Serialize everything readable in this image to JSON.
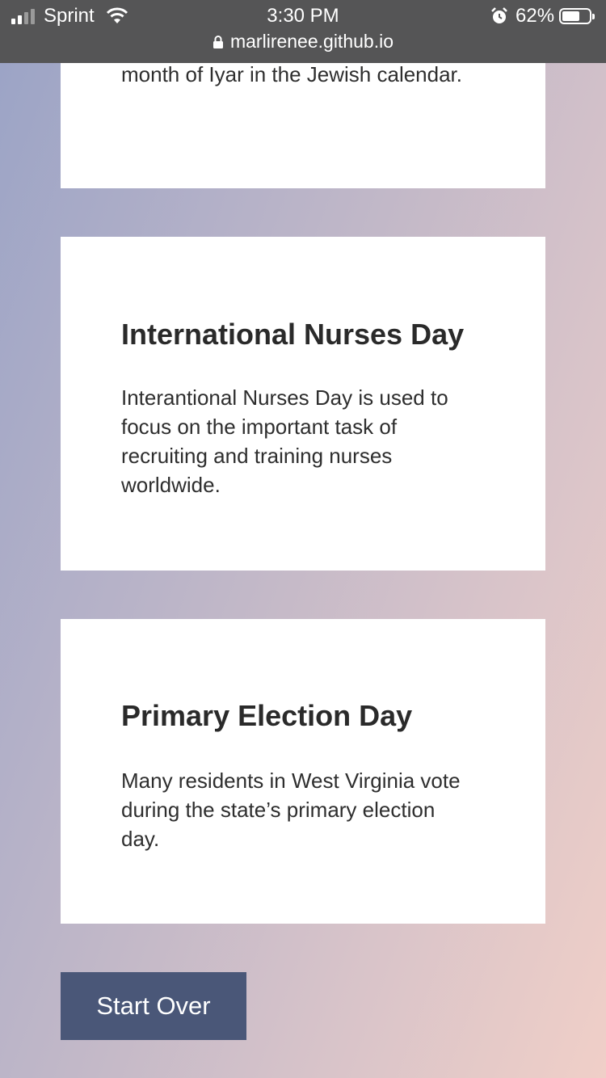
{
  "status_bar": {
    "carrier": "Sprint",
    "time": "3:30 PM",
    "battery": "62%",
    "url": "marlirenee.github.io"
  },
  "cards": [
    {
      "title": "",
      "body": "month of Iyar in the Jewish calendar."
    },
    {
      "title": "International Nurses Day",
      "body": "Interantional Nurses Day is used to focus on the important task of recruiting and training nurses worldwide."
    },
    {
      "title": "Primary Election Day",
      "body": "Many residents in West Virginia vote during the state’s primary election day."
    }
  ],
  "actions": {
    "start_over": "Start Over"
  },
  "colors": {
    "button": "#4a5778",
    "status_bar": "#555556",
    "card": "#ffffff"
  },
  "icons": [
    "signal-icon",
    "wifi-icon",
    "alarm-icon",
    "battery-icon",
    "lock-icon"
  ]
}
